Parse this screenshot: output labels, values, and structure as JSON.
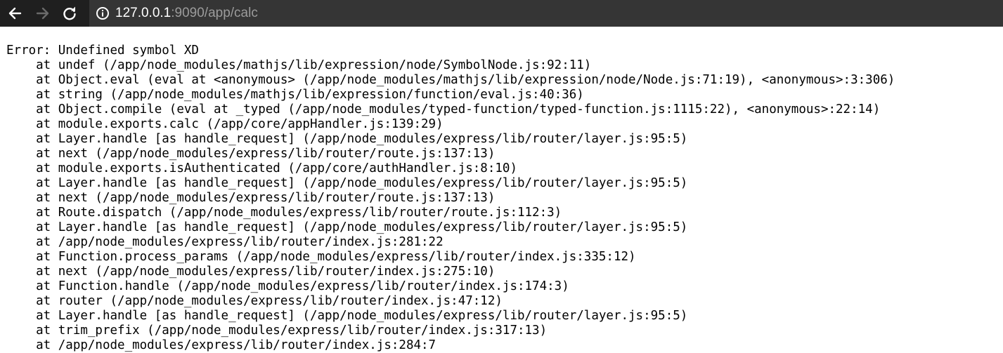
{
  "browser": {
    "url_host": "127.0.0.1",
    "url_rest": ":9090/app/calc",
    "icons": {
      "back": "back-arrow-icon",
      "forward": "forward-arrow-icon",
      "reload": "reload-icon",
      "info": "info-icon"
    }
  },
  "error": {
    "lines": [
      "Error: Undefined symbol XD",
      "    at undef (/app/node_modules/mathjs/lib/expression/node/SymbolNode.js:92:11)",
      "    at Object.eval (eval at <anonymous> (/app/node_modules/mathjs/lib/expression/node/Node.js:71:19), <anonymous>:3:306)",
      "    at string (/app/node_modules/mathjs/lib/expression/function/eval.js:40:36)",
      "    at Object.compile (eval at _typed (/app/node_modules/typed-function/typed-function.js:1115:22), <anonymous>:22:14)",
      "    at module.exports.calc (/app/core/appHandler.js:139:29)",
      "    at Layer.handle [as handle_request] (/app/node_modules/express/lib/router/layer.js:95:5)",
      "    at next (/app/node_modules/express/lib/router/route.js:137:13)",
      "    at module.exports.isAuthenticated (/app/core/authHandler.js:8:10)",
      "    at Layer.handle [as handle_request] (/app/node_modules/express/lib/router/layer.js:95:5)",
      "    at next (/app/node_modules/express/lib/router/route.js:137:13)",
      "    at Route.dispatch (/app/node_modules/express/lib/router/route.js:112:3)",
      "    at Layer.handle [as handle_request] (/app/node_modules/express/lib/router/layer.js:95:5)",
      "    at /app/node_modules/express/lib/router/index.js:281:22",
      "    at Function.process_params (/app/node_modules/express/lib/router/index.js:335:12)",
      "    at next (/app/node_modules/express/lib/router/index.js:275:10)",
      "    at Function.handle (/app/node_modules/express/lib/router/index.js:174:3)",
      "    at router (/app/node_modules/express/lib/router/index.js:47:12)",
      "    at Layer.handle [as handle_request] (/app/node_modules/express/lib/router/layer.js:95:5)",
      "    at trim_prefix (/app/node_modules/express/lib/router/index.js:317:13)",
      "    at /app/node_modules/express/lib/router/index.js:284:7"
    ]
  }
}
